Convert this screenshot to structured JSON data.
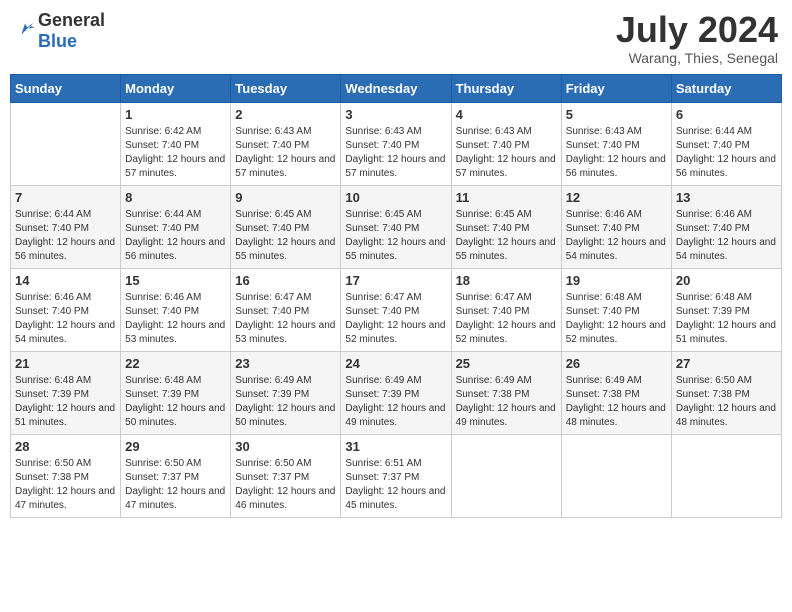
{
  "header": {
    "logo_general": "General",
    "logo_blue": "Blue",
    "month_year": "July 2024",
    "location": "Warang, Thies, Senegal"
  },
  "calendar": {
    "days_of_week": [
      "Sunday",
      "Monday",
      "Tuesday",
      "Wednesday",
      "Thursday",
      "Friday",
      "Saturday"
    ],
    "weeks": [
      [
        {
          "day": "",
          "info": ""
        },
        {
          "day": "1",
          "info": "Sunrise: 6:42 AM\nSunset: 7:40 PM\nDaylight: 12 hours and 57 minutes."
        },
        {
          "day": "2",
          "info": "Sunrise: 6:43 AM\nSunset: 7:40 PM\nDaylight: 12 hours and 57 minutes."
        },
        {
          "day": "3",
          "info": "Sunrise: 6:43 AM\nSunset: 7:40 PM\nDaylight: 12 hours and 57 minutes."
        },
        {
          "day": "4",
          "info": "Sunrise: 6:43 AM\nSunset: 7:40 PM\nDaylight: 12 hours and 57 minutes."
        },
        {
          "day": "5",
          "info": "Sunrise: 6:43 AM\nSunset: 7:40 PM\nDaylight: 12 hours and 56 minutes."
        },
        {
          "day": "6",
          "info": "Sunrise: 6:44 AM\nSunset: 7:40 PM\nDaylight: 12 hours and 56 minutes."
        }
      ],
      [
        {
          "day": "7",
          "info": "Sunrise: 6:44 AM\nSunset: 7:40 PM\nDaylight: 12 hours and 56 minutes."
        },
        {
          "day": "8",
          "info": "Sunrise: 6:44 AM\nSunset: 7:40 PM\nDaylight: 12 hours and 56 minutes."
        },
        {
          "day": "9",
          "info": "Sunrise: 6:45 AM\nSunset: 7:40 PM\nDaylight: 12 hours and 55 minutes."
        },
        {
          "day": "10",
          "info": "Sunrise: 6:45 AM\nSunset: 7:40 PM\nDaylight: 12 hours and 55 minutes."
        },
        {
          "day": "11",
          "info": "Sunrise: 6:45 AM\nSunset: 7:40 PM\nDaylight: 12 hours and 55 minutes."
        },
        {
          "day": "12",
          "info": "Sunrise: 6:46 AM\nSunset: 7:40 PM\nDaylight: 12 hours and 54 minutes."
        },
        {
          "day": "13",
          "info": "Sunrise: 6:46 AM\nSunset: 7:40 PM\nDaylight: 12 hours and 54 minutes."
        }
      ],
      [
        {
          "day": "14",
          "info": "Sunrise: 6:46 AM\nSunset: 7:40 PM\nDaylight: 12 hours and 54 minutes."
        },
        {
          "day": "15",
          "info": "Sunrise: 6:46 AM\nSunset: 7:40 PM\nDaylight: 12 hours and 53 minutes."
        },
        {
          "day": "16",
          "info": "Sunrise: 6:47 AM\nSunset: 7:40 PM\nDaylight: 12 hours and 53 minutes."
        },
        {
          "day": "17",
          "info": "Sunrise: 6:47 AM\nSunset: 7:40 PM\nDaylight: 12 hours and 52 minutes."
        },
        {
          "day": "18",
          "info": "Sunrise: 6:47 AM\nSunset: 7:40 PM\nDaylight: 12 hours and 52 minutes."
        },
        {
          "day": "19",
          "info": "Sunrise: 6:48 AM\nSunset: 7:40 PM\nDaylight: 12 hours and 52 minutes."
        },
        {
          "day": "20",
          "info": "Sunrise: 6:48 AM\nSunset: 7:39 PM\nDaylight: 12 hours and 51 minutes."
        }
      ],
      [
        {
          "day": "21",
          "info": "Sunrise: 6:48 AM\nSunset: 7:39 PM\nDaylight: 12 hours and 51 minutes."
        },
        {
          "day": "22",
          "info": "Sunrise: 6:48 AM\nSunset: 7:39 PM\nDaylight: 12 hours and 50 minutes."
        },
        {
          "day": "23",
          "info": "Sunrise: 6:49 AM\nSunset: 7:39 PM\nDaylight: 12 hours and 50 minutes."
        },
        {
          "day": "24",
          "info": "Sunrise: 6:49 AM\nSunset: 7:39 PM\nDaylight: 12 hours and 49 minutes."
        },
        {
          "day": "25",
          "info": "Sunrise: 6:49 AM\nSunset: 7:38 PM\nDaylight: 12 hours and 49 minutes."
        },
        {
          "day": "26",
          "info": "Sunrise: 6:49 AM\nSunset: 7:38 PM\nDaylight: 12 hours and 48 minutes."
        },
        {
          "day": "27",
          "info": "Sunrise: 6:50 AM\nSunset: 7:38 PM\nDaylight: 12 hours and 48 minutes."
        }
      ],
      [
        {
          "day": "28",
          "info": "Sunrise: 6:50 AM\nSunset: 7:38 PM\nDaylight: 12 hours and 47 minutes."
        },
        {
          "day": "29",
          "info": "Sunrise: 6:50 AM\nSunset: 7:37 PM\nDaylight: 12 hours and 47 minutes."
        },
        {
          "day": "30",
          "info": "Sunrise: 6:50 AM\nSunset: 7:37 PM\nDaylight: 12 hours and 46 minutes."
        },
        {
          "day": "31",
          "info": "Sunrise: 6:51 AM\nSunset: 7:37 PM\nDaylight: 12 hours and 45 minutes."
        },
        {
          "day": "",
          "info": ""
        },
        {
          "day": "",
          "info": ""
        },
        {
          "day": "",
          "info": ""
        }
      ]
    ]
  }
}
